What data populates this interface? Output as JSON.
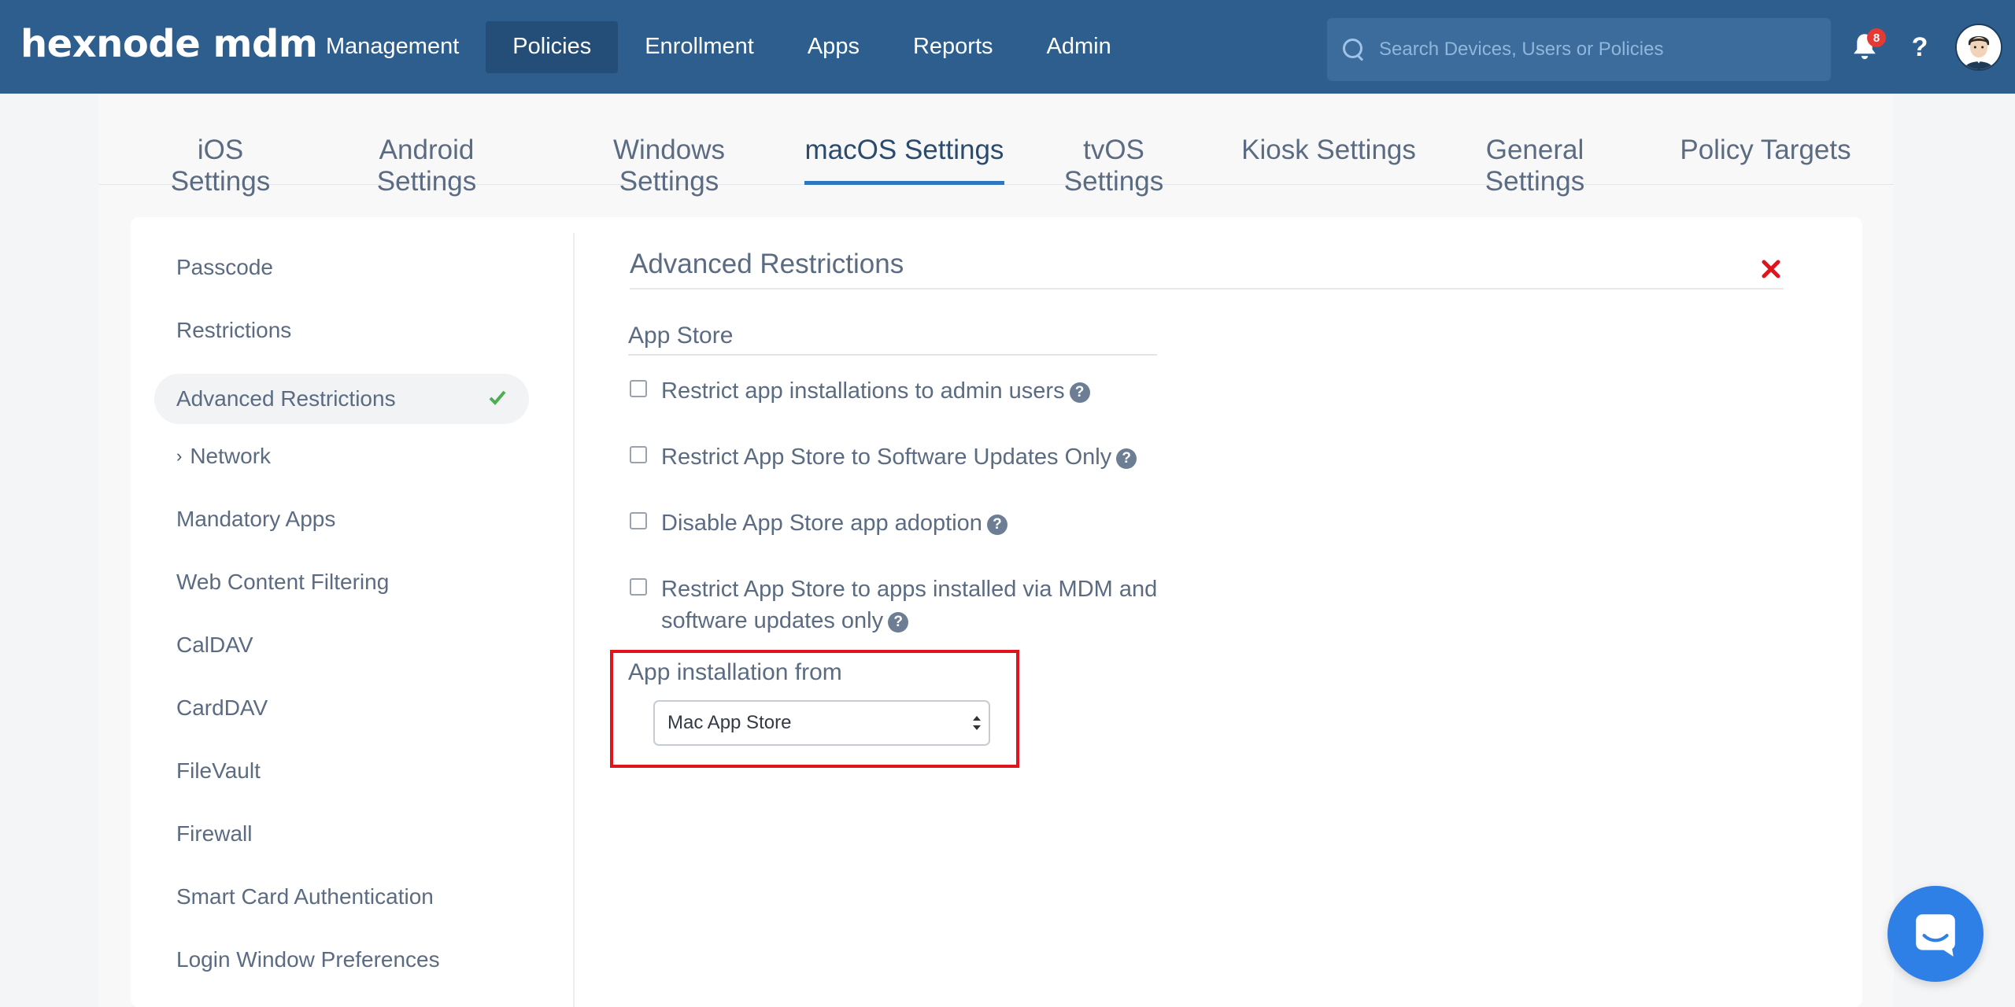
{
  "app": {
    "logo_text": "hexnode mdm"
  },
  "nav": {
    "items": [
      {
        "label": "Management"
      },
      {
        "label": "Policies"
      },
      {
        "label": "Enrollment"
      },
      {
        "label": "Apps"
      },
      {
        "label": "Reports"
      },
      {
        "label": "Admin"
      }
    ],
    "active": "Policies"
  },
  "search": {
    "placeholder": "Search Devices, Users or Policies",
    "value": ""
  },
  "notifications": {
    "count": "8"
  },
  "help": {
    "label": "?"
  },
  "tabs": {
    "items": [
      {
        "label": "iOS Settings"
      },
      {
        "label": "Android Settings"
      },
      {
        "label": "Windows Settings"
      },
      {
        "label": "macOS Settings"
      },
      {
        "label": "tvOS Settings"
      },
      {
        "label": "Kiosk Settings"
      },
      {
        "label": "General Settings"
      },
      {
        "label": "Policy Targets"
      }
    ],
    "active": "macOS Settings"
  },
  "sidebar": {
    "items": [
      {
        "label": "Passcode"
      },
      {
        "label": "Restrictions"
      },
      {
        "label": "Advanced Restrictions"
      },
      {
        "label": "Network"
      },
      {
        "label": "Mandatory Apps"
      },
      {
        "label": "Web Content Filtering"
      },
      {
        "label": "CalDAV"
      },
      {
        "label": "CardDAV"
      },
      {
        "label": "FileVault"
      },
      {
        "label": "Firewall"
      },
      {
        "label": "Smart Card Authentication"
      },
      {
        "label": "Login Window Preferences"
      }
    ],
    "active": "Advanced Restrictions"
  },
  "main": {
    "section_title": "Advanced Restrictions",
    "group_title": "App Store",
    "options": [
      {
        "label": "Restrict app installations to admin users",
        "checked": false
      },
      {
        "label": "Restrict App Store to Software Updates Only",
        "checked": false
      },
      {
        "label": "Disable App Store app adoption",
        "checked": false
      },
      {
        "label_line1": "Restrict App Store to apps installed via MDM and",
        "label_line2": "software updates only",
        "checked": false
      }
    ],
    "app_installation": {
      "label": "App installation from",
      "selected": "Mac App Store"
    }
  },
  "colors": {
    "topbar": "#2d5e8e",
    "active_nav": "#244e78",
    "tab_underline": "#2f75c0",
    "highlight_border": "#e0141c",
    "check_green": "#4caf50",
    "chat_button": "#2f80e6"
  }
}
